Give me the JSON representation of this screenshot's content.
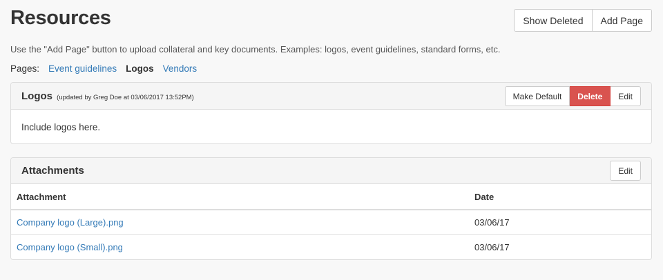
{
  "page": {
    "title": "Resources",
    "help_text": "Use the \"Add Page\" button to upload collateral and key documents. Examples: logos, event guidelines, standard forms, etc."
  },
  "top_actions": {
    "show_deleted": "Show Deleted",
    "add_page": "Add Page"
  },
  "pages_nav": {
    "label": "Pages:",
    "items": [
      {
        "label": "Event guidelines",
        "active": false
      },
      {
        "label": "Logos",
        "active": true
      },
      {
        "label": "Vendors",
        "active": false
      }
    ]
  },
  "logos_panel": {
    "title": "Logos",
    "meta": "(updated by Greg Doe at 03/06/2017 13:52PM)",
    "make_default": "Make Default",
    "delete": "Delete",
    "edit": "Edit",
    "body": "Include logos here."
  },
  "attachments_panel": {
    "title": "Attachments",
    "edit": "Edit",
    "columns": [
      "Attachment",
      "Date"
    ],
    "rows": [
      {
        "name": "Company logo (Large).png",
        "date": "03/06/17"
      },
      {
        "name": "Company logo (Small).png",
        "date": "03/06/17"
      }
    ]
  },
  "colors": {
    "link": "#337ab7",
    "danger": "#d9534f",
    "background": "#f8f8f8"
  }
}
